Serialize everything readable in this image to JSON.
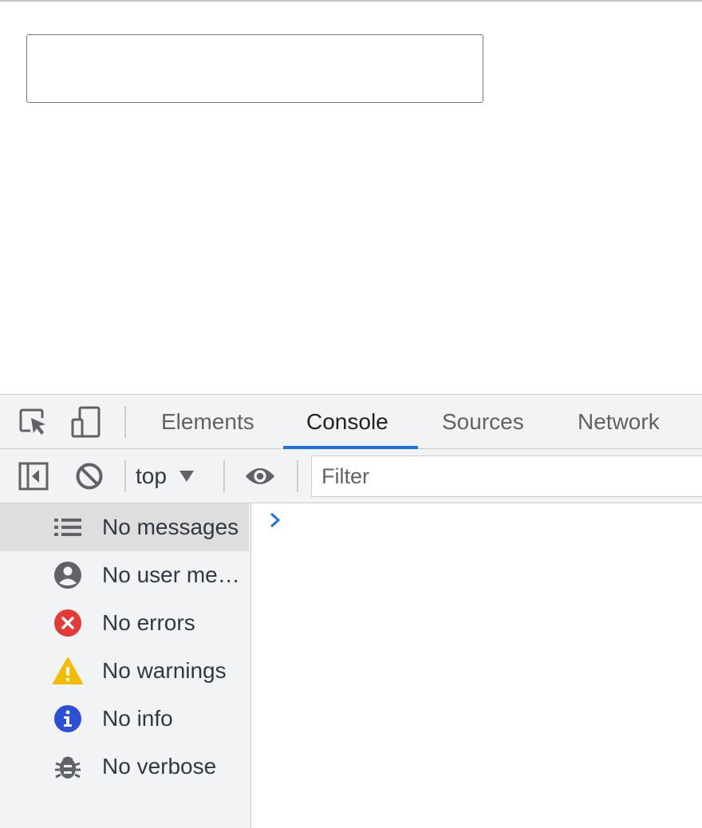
{
  "devtools": {
    "tabs": [
      {
        "label": "Elements"
      },
      {
        "label": "Console"
      },
      {
        "label": "Sources"
      },
      {
        "label": "Network"
      }
    ],
    "active_tab": "Console",
    "toolbar": {
      "context": "top",
      "filter_placeholder": "Filter"
    },
    "sidebar": {
      "items": [
        {
          "label": "No messages",
          "icon": "list-icon",
          "color": "#5f6368"
        },
        {
          "label": "No user me…",
          "icon": "user-icon",
          "color": "#5f6368"
        },
        {
          "label": "No errors",
          "icon": "error-icon",
          "color": "#e53935"
        },
        {
          "label": "No warnings",
          "icon": "warning-icon",
          "color": "#f4bc00"
        },
        {
          "label": "No info",
          "icon": "info-icon",
          "color": "#2b50d6"
        },
        {
          "label": "No verbose",
          "icon": "bug-icon",
          "color": "#5f6368"
        }
      ]
    },
    "colors": {
      "accent": "#1a73e8",
      "prompt": "#1a73e8"
    }
  }
}
